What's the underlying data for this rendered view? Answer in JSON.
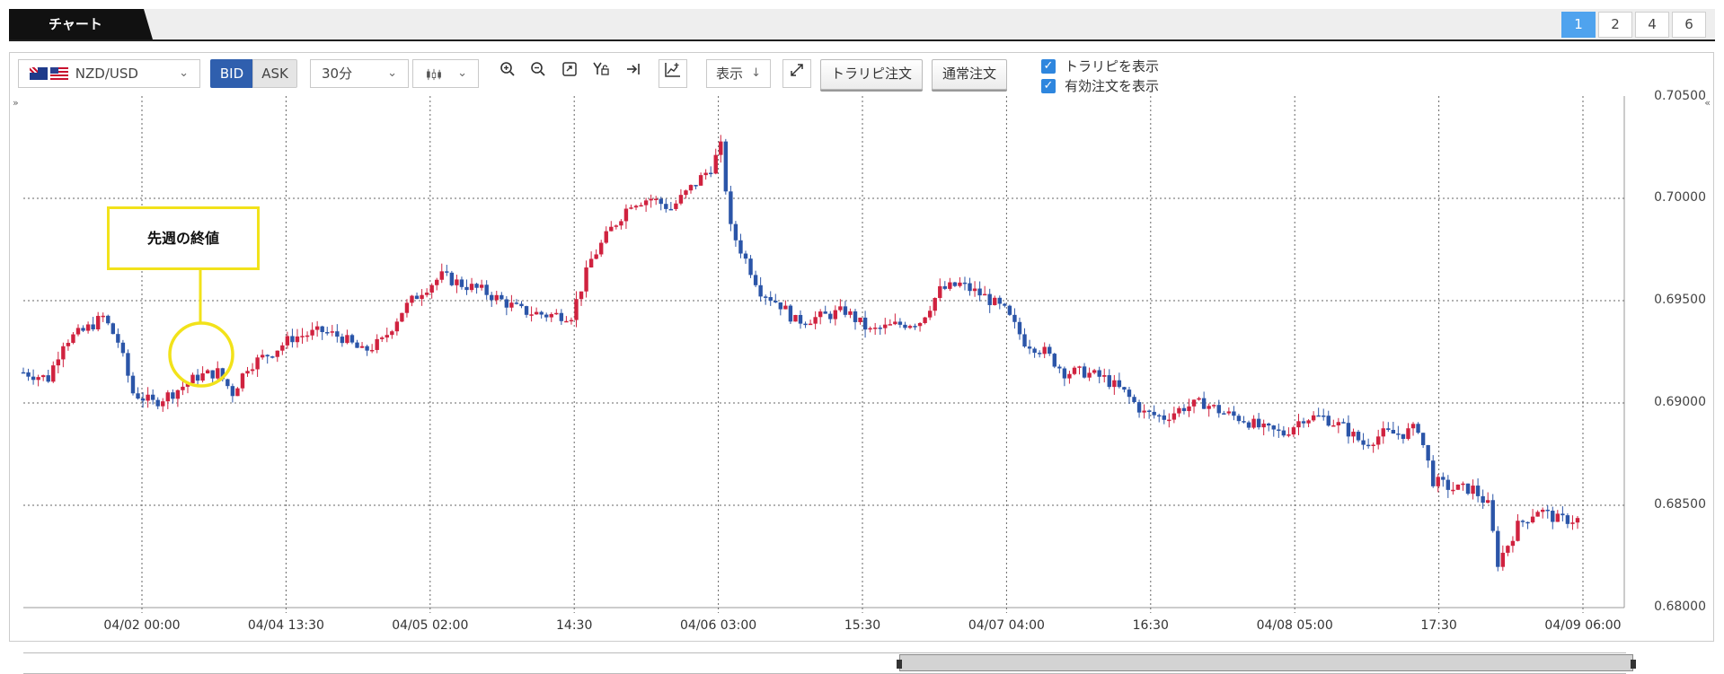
{
  "header": {
    "active_tab": "チャート",
    "layout_buttons": [
      "1",
      "2",
      "4",
      "6"
    ],
    "active_layout": "1"
  },
  "toolbar": {
    "symbol": "NZD/USD",
    "bid_label": "BID",
    "ask_label": "ASK",
    "period": "30分",
    "display_label": "表示",
    "trailing_order_button": "トラリピ注文",
    "normal_order_button": "通常注文",
    "show_trailing_checkbox": "トラリピを表示",
    "show_active_orders_checkbox": "有効注文を表示"
  },
  "annotation": {
    "label": "先週の終値"
  },
  "colors": {
    "up": "#d0223f",
    "down": "#2b55a8",
    "accent": "#4fa3ee",
    "annotation": "#f2e21a"
  },
  "chart_data": {
    "type": "candlestick",
    "y_ticks": [
      "0.70500",
      "0.70000",
      "0.69500",
      "0.69000",
      "0.68500",
      "0.68000"
    ],
    "x_ticks": [
      "04/02 00:00",
      "04/04 13:30",
      "04/05 02:00",
      "14:30",
      "04/06 03:00",
      "15:30",
      "04/07 04:00",
      "16:30",
      "04/08 05:00",
      "17:30",
      "04/09 06:00"
    ],
    "ylim": [
      0.68,
      0.705
    ],
    "grid": true,
    "close_path": [
      [
        0,
        0.6915
      ],
      [
        5,
        0.6912
      ],
      [
        8,
        0.693
      ],
      [
        12,
        0.6935
      ],
      [
        16,
        0.6942
      ],
      [
        19,
        0.693
      ],
      [
        22,
        0.6905
      ],
      [
        26,
        0.69
      ],
      [
        30,
        0.6905
      ],
      [
        35,
        0.6913
      ],
      [
        39,
        0.6915
      ],
      [
        42,
        0.6905
      ],
      [
        45,
        0.6918
      ],
      [
        50,
        0.6925
      ],
      [
        54,
        0.6932
      ],
      [
        60,
        0.6935
      ],
      [
        64,
        0.6932
      ],
      [
        68,
        0.6925
      ],
      [
        72,
        0.693
      ],
      [
        76,
        0.6945
      ],
      [
        80,
        0.6955
      ],
      [
        84,
        0.6962
      ],
      [
        88,
        0.6958
      ],
      [
        92,
        0.6955
      ],
      [
        96,
        0.695
      ],
      [
        100,
        0.6945
      ],
      [
        105,
        0.6943
      ],
      [
        110,
        0.6943
      ],
      [
        114,
        0.697
      ],
      [
        118,
        0.6985
      ],
      [
        122,
        0.6998
      ],
      [
        126,
        0.7
      ],
      [
        130,
        0.6995
      ],
      [
        134,
        0.7005
      ],
      [
        138,
        0.7015
      ],
      [
        140,
        0.7025
      ],
      [
        142,
        0.6985
      ],
      [
        145,
        0.697
      ],
      [
        148,
        0.6955
      ],
      [
        152,
        0.6948
      ],
      [
        155,
        0.694
      ],
      [
        160,
        0.6942
      ],
      [
        165,
        0.6945
      ],
      [
        170,
        0.6935
      ],
      [
        175,
        0.6938
      ],
      [
        180,
        0.694
      ],
      [
        184,
        0.6955
      ],
      [
        188,
        0.6958
      ],
      [
        193,
        0.6952
      ],
      [
        197,
        0.6945
      ],
      [
        201,
        0.693
      ],
      [
        205,
        0.6925
      ],
      [
        209,
        0.6915
      ],
      [
        213,
        0.6915
      ],
      [
        217,
        0.6912
      ],
      [
        221,
        0.6905
      ],
      [
        225,
        0.6895
      ],
      [
        229,
        0.6893
      ],
      [
        233,
        0.6898
      ],
      [
        237,
        0.69
      ],
      [
        241,
        0.6895
      ],
      [
        245,
        0.6892
      ],
      [
        249,
        0.6887
      ],
      [
        253,
        0.6885
      ],
      [
        257,
        0.6893
      ],
      [
        261,
        0.6893
      ],
      [
        265,
        0.6888
      ],
      [
        269,
        0.688
      ],
      [
        273,
        0.6885
      ],
      [
        277,
        0.6885
      ],
      [
        280,
        0.6888
      ],
      [
        283,
        0.6862
      ],
      [
        287,
        0.6858
      ],
      [
        291,
        0.6858
      ],
      [
        294,
        0.685
      ],
      [
        296,
        0.6822
      ],
      [
        300,
        0.684
      ],
      [
        304,
        0.6848
      ],
      [
        308,
        0.6843
      ],
      [
        312,
        0.6843
      ]
    ]
  }
}
